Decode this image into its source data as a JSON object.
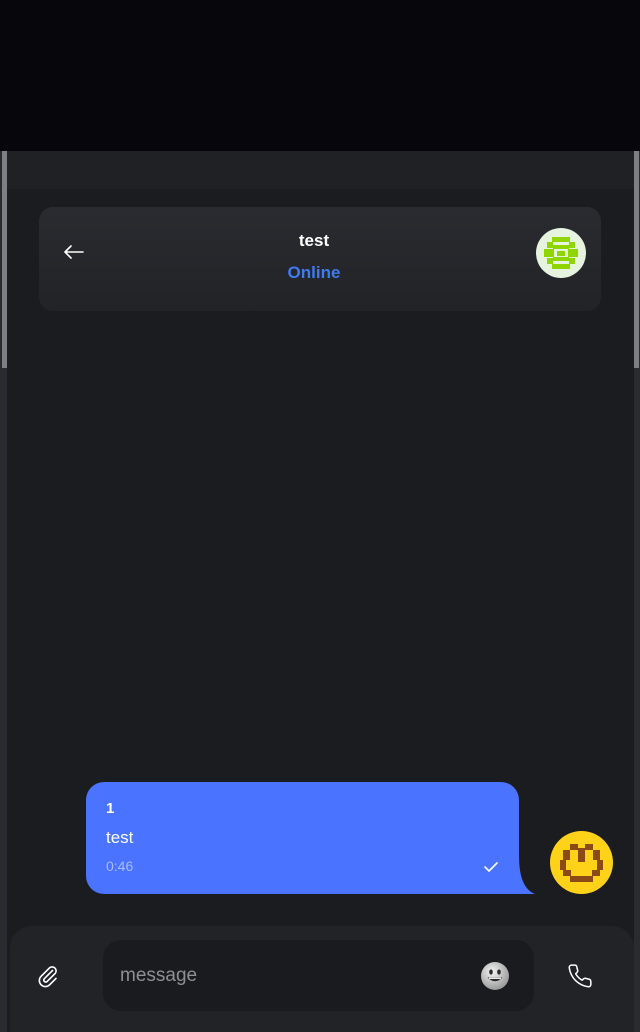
{
  "chat": {
    "title": "test",
    "status": "Online"
  },
  "message": {
    "sender": "1",
    "text": "test",
    "time": "0:46"
  },
  "composer": {
    "placeholder": "message"
  },
  "colors": {
    "accent": "#4a73ff",
    "status_online": "#3f7bf0",
    "background": "#1b1c20",
    "contact_avatar": "#8fd600",
    "user_avatar": "#ffd21a"
  },
  "icons": {
    "back": "arrow-left-icon",
    "attach": "paperclip-icon",
    "emoji": "smiley-icon",
    "call": "phone-icon",
    "read_receipt": "checkmark-icon"
  }
}
